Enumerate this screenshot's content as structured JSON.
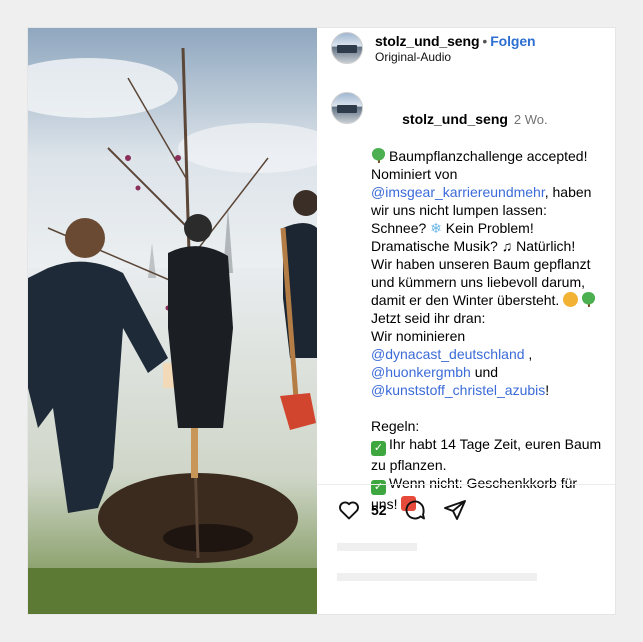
{
  "header": {
    "username": "stolz_und_seng",
    "separator": "•",
    "follow_label": "Folgen",
    "audio_label": "Original-Audio"
  },
  "caption": {
    "username": "stolz_und_seng",
    "time": "2 Wo.",
    "line1": "Baumpflanzchallenge accepted!",
    "line2": "Nominiert von",
    "mention1": "@imsgear_karriereundmehr",
    "line3_suffix": ", haben",
    "line4": "wir uns nicht lumpen lassen:",
    "line5_a": "Schnee? ",
    "line5_b": " Kein Problem!",
    "line6_a": "Dramatische Musik? ",
    "line6_b": " Natürlich!",
    "line7": "Wir haben unseren Baum gepflanzt",
    "line8": "und kümmern uns liebevoll darum,",
    "line9": "damit er den Winter übersteht. ",
    "line10": "Jetzt seid ihr dran:",
    "line11": "Wir nominieren",
    "mention2": "@dynacast_deutschland",
    "mention2_suffix": " ,",
    "mention3": "@huonkergmbh",
    "mention3_suffix": " und",
    "mention4": "@kunststoff_christel_azubis",
    "mention4_suffix": "!",
    "rules_title": "Regeln:",
    "rule1_a": "Ihr habt 14 Tage Zeit, euren Baum",
    "rule1_b": "zu pflanzen.",
    "rule2_a": "Wenn nicht: Geschenkkorb für",
    "rule2_b": "uns! "
  },
  "actions": {
    "like_count": "52"
  },
  "icons": [
    "avatar",
    "heart-icon",
    "comment-icon",
    "share-icon",
    "tree-emoji",
    "snowflake-emoji",
    "music-emoji",
    "muscle-emoji",
    "check-emoji",
    "gift-emoji"
  ],
  "colors": {
    "link": "#3b6bd8",
    "follow": "#2e6fd1",
    "muted": "#737373"
  }
}
